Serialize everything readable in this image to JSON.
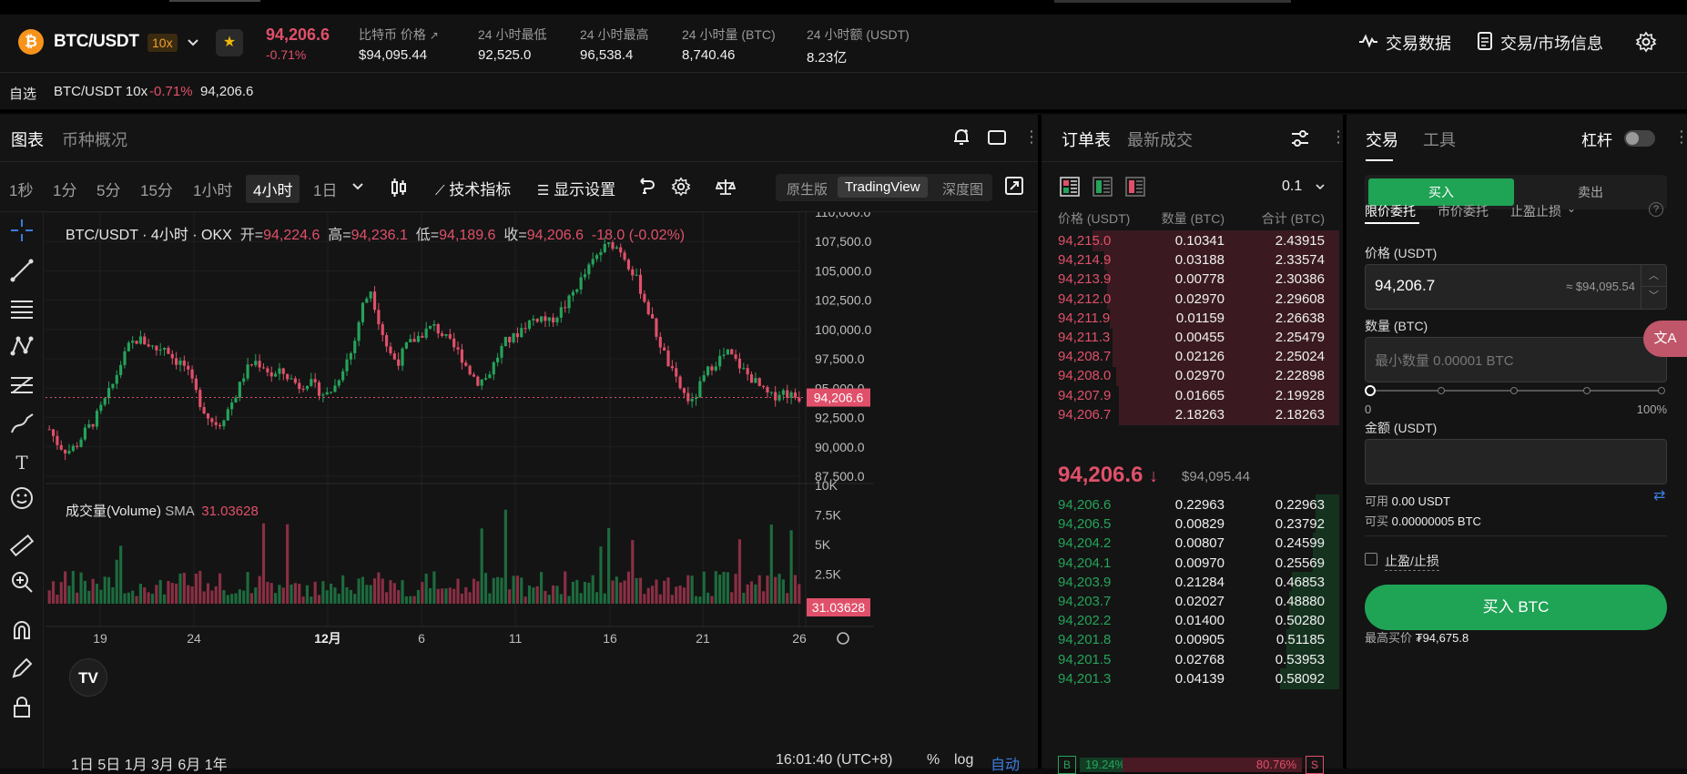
{
  "header": {
    "pair": "BTC/USDT",
    "leverage": "10x",
    "last_price": "94,206.6",
    "change_pct": "-0.71%",
    "stats": [
      {
        "label": "比特币 价格",
        "value": "$94,095.44"
      },
      {
        "label": "24 小时最低",
        "value": "92,525.0"
      },
      {
        "label": "24 小时最高",
        "value": "96,538.4"
      },
      {
        "label": "24 小时量 (BTC)",
        "value": "8,740.46"
      },
      {
        "label": "24 小时额 (USDT)",
        "value": "8.23亿"
      }
    ],
    "trade_data": "交易数据",
    "market_info": "交易/市场信息"
  },
  "favorites": {
    "label": "自选",
    "pair": "BTC/USDT 10x",
    "change": "-0.71%",
    "price": "94,206.6"
  },
  "chart_panel": {
    "tabs": [
      "图表",
      "币种概况"
    ],
    "timeframes": [
      "1秒",
      "1分",
      "5分",
      "15分",
      "1小时",
      "4小时",
      "1日"
    ],
    "active_timeframe": "4小时",
    "indicators_label": "技术指标",
    "display_label": "显示设置",
    "views": [
      "原生版",
      "TradingView",
      "深度图"
    ],
    "active_view": "TradingView",
    "info": {
      "title": "BTC/USDT · 4小时 · OKX",
      "open_label": "开=",
      "open": "94,224.6",
      "high_label": "高=",
      "high": "94,236.1",
      "low_label": "低=",
      "low": "94,189.6",
      "close_label": "收=",
      "close": "94,206.6",
      "change": "-18.0 (-0.02%)"
    },
    "volume": {
      "label": "成交量(Volume)",
      "sma_label": "SMA",
      "sma_value": "31.03628"
    },
    "ranges": "1日  5日  1月  3月  6月  1年",
    "clock": "16:01:40 (UTC+8)",
    "scale_opts": [
      "%",
      "log",
      "自动"
    ]
  },
  "chart_data": {
    "type": "candlestick",
    "price_axis": [
      "110,000.0",
      "107,500.0",
      "105,000.0",
      "102,500.0",
      "100,000.0",
      "97,500.0",
      "95,000.0",
      "92,500.0",
      "90,000.0",
      "87,500.0"
    ],
    "ylim": [
      87500,
      110000
    ],
    "volume_axis": [
      "10K",
      "7.5K",
      "5K",
      "2.5K"
    ],
    "volume_ylim": [
      0,
      10000
    ],
    "x_ticks": [
      "19",
      "24",
      "12月",
      "6",
      "11",
      "16",
      "21",
      "26"
    ],
    "current_price_tag": "94,206.6",
    "current_volume_tag": "31.03628",
    "close_path": [
      91500,
      90200,
      89600,
      90100,
      91300,
      92200,
      93600,
      95100,
      97100,
      98700,
      99200,
      98800,
      98300,
      98600,
      97400,
      97100,
      95400,
      93600,
      92300,
      91900,
      93200,
      94600,
      96500,
      97300,
      96900,
      96000,
      96400,
      95800,
      95200,
      95600,
      94900,
      94400,
      95200,
      97000,
      98300,
      101900,
      103400,
      100500,
      98100,
      97200,
      98600,
      99200,
      99800,
      100300,
      99600,
      98700,
      97900,
      96500,
      95600,
      95900,
      97400,
      98900,
      99300,
      100200,
      100800,
      101100,
      100600,
      101400,
      102200,
      103600,
      104700,
      105900,
      106900,
      107300,
      106800,
      105400,
      103900,
      101800,
      99600,
      97700,
      95900,
      94600,
      93700,
      95400,
      96800,
      97500,
      98000,
      97200,
      96300,
      95600,
      94700,
      94200,
      94800,
      94400,
      94206
    ]
  },
  "orderbook": {
    "tabs": [
      "订单表",
      "最新成交"
    ],
    "tick": "0.1",
    "headers": [
      "价格 (USDT)",
      "数量 (BTC)",
      "合计 (BTC)"
    ],
    "asks": [
      {
        "price": "94,215.0",
        "amount": "0.10341",
        "total": "2.43915",
        "depth": 0.84
      },
      {
        "price": "94,214.9",
        "amount": "0.03188",
        "total": "2.33574",
        "depth": 0.8
      },
      {
        "price": "94,213.9",
        "amount": "0.00778",
        "total": "2.30386",
        "depth": 0.79
      },
      {
        "price": "94,212.0",
        "amount": "0.02970",
        "total": "2.29608",
        "depth": 0.79
      },
      {
        "price": "94,211.9",
        "amount": "0.01159",
        "total": "2.26638",
        "depth": 0.78
      },
      {
        "price": "94,211.3",
        "amount": "0.00455",
        "total": "2.25479",
        "depth": 0.77
      },
      {
        "price": "94,208.7",
        "amount": "0.02126",
        "total": "2.25024",
        "depth": 0.77
      },
      {
        "price": "94,208.0",
        "amount": "0.02970",
        "total": "2.22898",
        "depth": 0.76
      },
      {
        "price": "94,207.9",
        "amount": "0.01665",
        "total": "2.19928",
        "depth": 0.75
      },
      {
        "price": "94,206.7",
        "amount": "2.18263",
        "total": "2.18263",
        "depth": 0.75
      }
    ],
    "mid_price": "94,206.6",
    "mid_usd": "$94,095.44",
    "bids": [
      {
        "price": "94,206.6",
        "amount": "0.22963",
        "total": "0.22963",
        "depth": 0.08
      },
      {
        "price": "94,206.5",
        "amount": "0.00829",
        "total": "0.23792",
        "depth": 0.08
      },
      {
        "price": "94,204.2",
        "amount": "0.00807",
        "total": "0.24599",
        "depth": 0.09
      },
      {
        "price": "94,204.1",
        "amount": "0.00970",
        "total": "0.25569",
        "depth": 0.09
      },
      {
        "price": "94,203.9",
        "amount": "0.21284",
        "total": "0.46853",
        "depth": 0.16
      },
      {
        "price": "94,203.7",
        "amount": "0.02027",
        "total": "0.48880",
        "depth": 0.17
      },
      {
        "price": "94,202.2",
        "amount": "0.01400",
        "total": "0.50280",
        "depth": 0.17
      },
      {
        "price": "94,201.8",
        "amount": "0.00905",
        "total": "0.51185",
        "depth": 0.18
      },
      {
        "price": "94,201.5",
        "amount": "0.02768",
        "total": "0.53953",
        "depth": 0.18
      },
      {
        "price": "94,201.3",
        "amount": "0.04139",
        "total": "0.58092",
        "depth": 0.2
      }
    ],
    "buy_ratio": "19.24%",
    "sell_ratio": "80.76%",
    "buy_letter": "B",
    "sell_letter": "S"
  },
  "trade": {
    "tabs": [
      "交易",
      "工具"
    ],
    "leverage_label": "杠杆",
    "buy_tab": "买入",
    "sell_tab": "卖出",
    "order_types": [
      "限价委托",
      "市价委托",
      "止盈止损"
    ],
    "price_label": "价格 (USDT)",
    "price_value": "94,206.7",
    "price_usd": "≈ $94,095.54",
    "qty_label": "数量 (BTC)",
    "qty_placeholder": "最小数量 0.00001 BTC",
    "slider_min": "0",
    "slider_max": "100%",
    "amount_label": "金额 (USDT)",
    "available_label": "可用",
    "available_value": "0.00 USDT",
    "buyable_label": "可买",
    "buyable_value": "0.00000005 BTC",
    "tpsl_label": "止盈/止损",
    "buy_button": "买入 BTC",
    "max_price_label": "最高买价",
    "max_price_value": "₮94,675.8"
  },
  "colors": {
    "up": "#25a35a",
    "down": "#e0506a",
    "buy_button": "#1fa355",
    "accent_orange": "#f7931a"
  }
}
